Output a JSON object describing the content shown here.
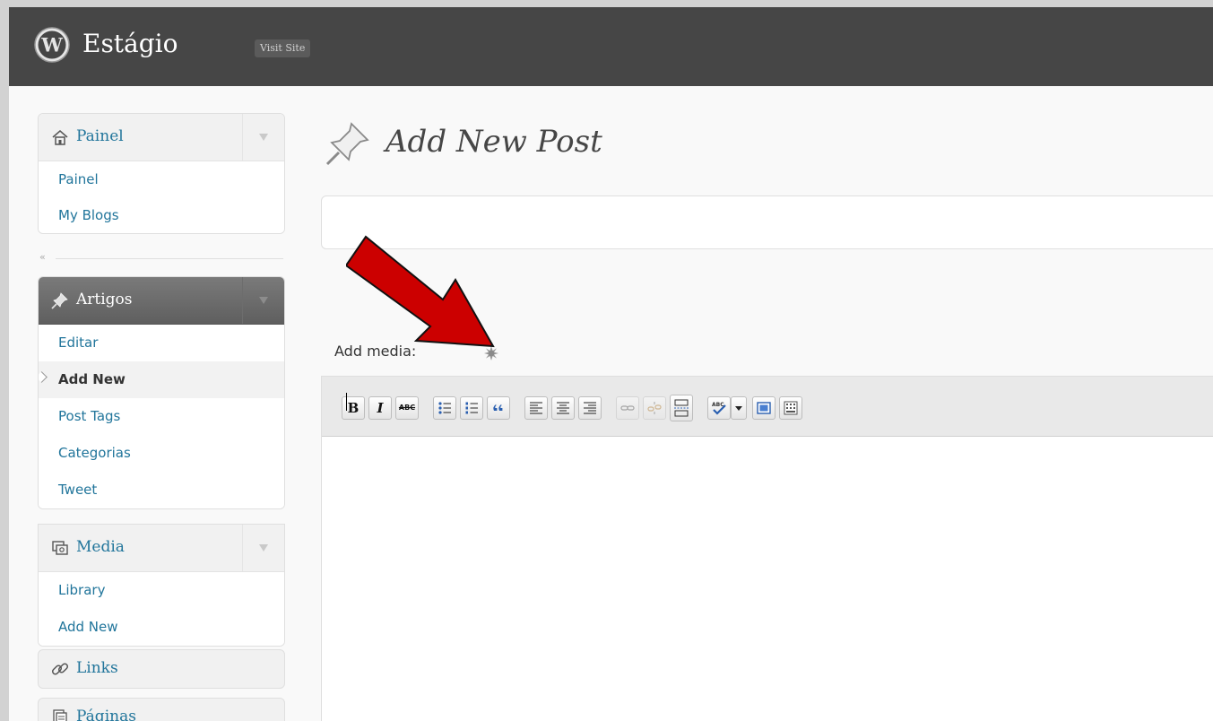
{
  "header": {
    "site_title": "Estágio",
    "visit_site_label": "Visit Site"
  },
  "sidebar": {
    "dashboard": {
      "label": "Painel",
      "items": [
        "Painel",
        "My Blogs"
      ]
    },
    "collapse_glyph": "«",
    "posts": {
      "label": "Artigos",
      "items": [
        "Editar",
        "Add New",
        "Post Tags",
        "Categorias",
        "Tweet"
      ],
      "current": "Add New"
    },
    "media": {
      "label": "Media",
      "items": [
        "Library",
        "Add New"
      ]
    },
    "links": {
      "label": "Links"
    },
    "pages": {
      "label": "Páginas"
    }
  },
  "main": {
    "page_title": "Add New Post",
    "title_input_value": "",
    "add_media_label": "Add media:",
    "toolbar": {
      "bold": "B",
      "italic": "I",
      "strike": "ABC"
    },
    "editor_content": ""
  },
  "icons": {
    "wp-logo": "wordpress-logo-icon",
    "dashboard": "home-icon",
    "posts": "pushpin-icon",
    "media": "media-icon",
    "links": "chain-link-icon",
    "pages": "pages-icon",
    "add-media": "star-burst-icon",
    "annotation": "red-arrow-icon"
  },
  "colors": {
    "header_bg": "#464646",
    "link": "#21759b",
    "annotation_arrow": "#cc0000"
  }
}
